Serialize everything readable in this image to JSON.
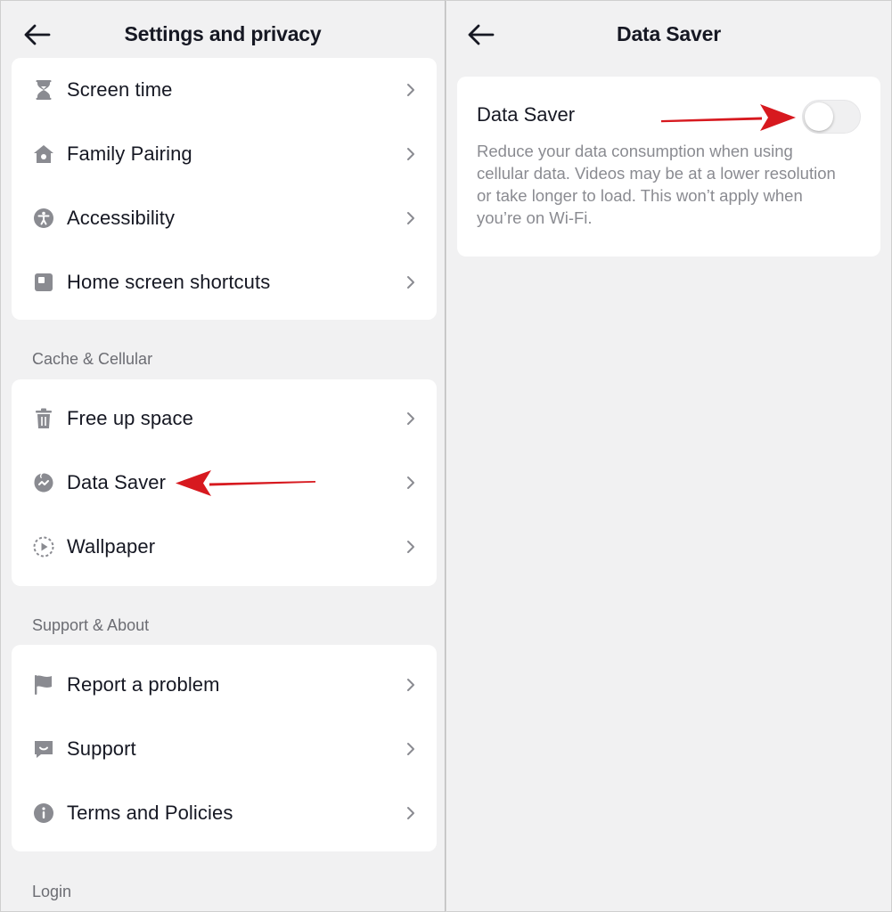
{
  "left": {
    "title": "Settings and privacy",
    "group1": [
      {
        "label": "Screen time",
        "icon": "hourglass-icon"
      },
      {
        "label": "Family Pairing",
        "icon": "home-icon"
      },
      {
        "label": "Accessibility",
        "icon": "accessibility-icon"
      },
      {
        "label": "Home screen shortcuts",
        "icon": "shortcut-icon"
      }
    ],
    "section_cache": "Cache & Cellular",
    "group2": [
      {
        "label": "Free up space",
        "icon": "trash-icon"
      },
      {
        "label": "Data Saver",
        "icon": "data-saver-icon"
      },
      {
        "label": "Wallpaper",
        "icon": "wallpaper-icon"
      }
    ],
    "section_support": "Support & About",
    "group3": [
      {
        "label": "Report a problem",
        "icon": "flag-icon"
      },
      {
        "label": "Support",
        "icon": "support-icon"
      },
      {
        "label": "Terms and Policies",
        "icon": "info-icon"
      }
    ],
    "section_login": "Login"
  },
  "right": {
    "title": "Data Saver",
    "setting_label": "Data Saver",
    "setting_description": "Reduce your data consumption when using cellular data. Videos may be at a lower resolution or take longer to load. This won’t apply when you’re on Wi-Fi.",
    "toggle_on": false
  },
  "colors": {
    "annotation_arrow": "#d7191f",
    "icon_gray": "#8a8b91",
    "background": "#f1f1f2",
    "card": "#ffffff"
  }
}
